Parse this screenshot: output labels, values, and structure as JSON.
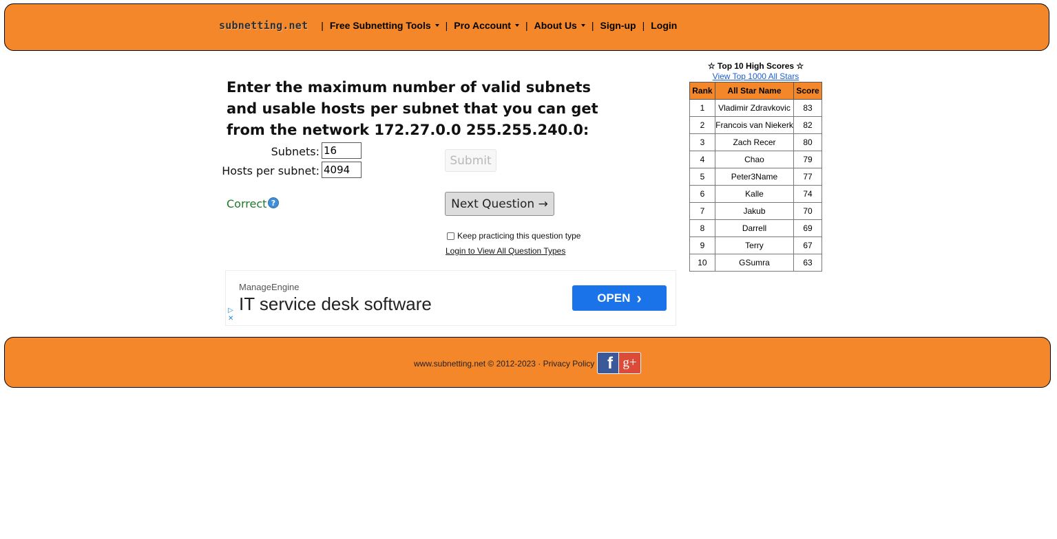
{
  "header": {
    "logo": "subnetting.net",
    "separator": "|",
    "nav": [
      {
        "label": "Free Subnetting Tools"
      },
      {
        "label": "Pro Account"
      },
      {
        "label": "About Us"
      },
      {
        "label": "Sign-up"
      },
      {
        "label": "Login"
      }
    ]
  },
  "question": {
    "text": "Enter the maximum number of valid subnets and usable hosts per subnet that you can get from the network 172.27.0.0 255.255.240.0:",
    "subnets_label": "Subnets:",
    "subnets_value": "16",
    "hosts_label": "Hosts per subnet:",
    "hosts_value": "4094",
    "result": "Correct",
    "help_icon": "?",
    "submit_label": "Submit",
    "next_label": "Next Question →",
    "keep_practicing": "Keep practicing this question type",
    "login_link": "Login to View All Question Types"
  },
  "ad": {
    "brand": "ManageEngine",
    "headline": "IT service desk software",
    "button": "OPEN",
    "button_chevron": "›",
    "play": "▷",
    "close": "✕"
  },
  "scores": {
    "title": "☆ Top 10 High Scores ☆",
    "link": "View Top 1000 All Stars",
    "headers": [
      "Rank",
      "All Star Name",
      "Score"
    ],
    "rows": [
      [
        "1",
        "Vladimir Zdravkovic",
        "83"
      ],
      [
        "2",
        "Francois van Niekerk",
        "82"
      ],
      [
        "3",
        "Zach Recer",
        "80"
      ],
      [
        "4",
        "Chao",
        "79"
      ],
      [
        "5",
        "Peter3Name",
        "77"
      ],
      [
        "6",
        "Kalle",
        "74"
      ],
      [
        "7",
        "Jakub",
        "70"
      ],
      [
        "8",
        "Darrell",
        "69"
      ],
      [
        "9",
        "Terry",
        "67"
      ],
      [
        "10",
        "GSumra",
        "63"
      ]
    ]
  },
  "footer": {
    "text": "www.subnetting.net © 2012-2023 · Privacy Policy",
    "facebook": "f",
    "google_plus": "g+"
  },
  "colors": {
    "accent": "#f48729",
    "correct": "#1e7a28",
    "link": "#1a5fd6",
    "ad_button": "#1a73e8"
  }
}
